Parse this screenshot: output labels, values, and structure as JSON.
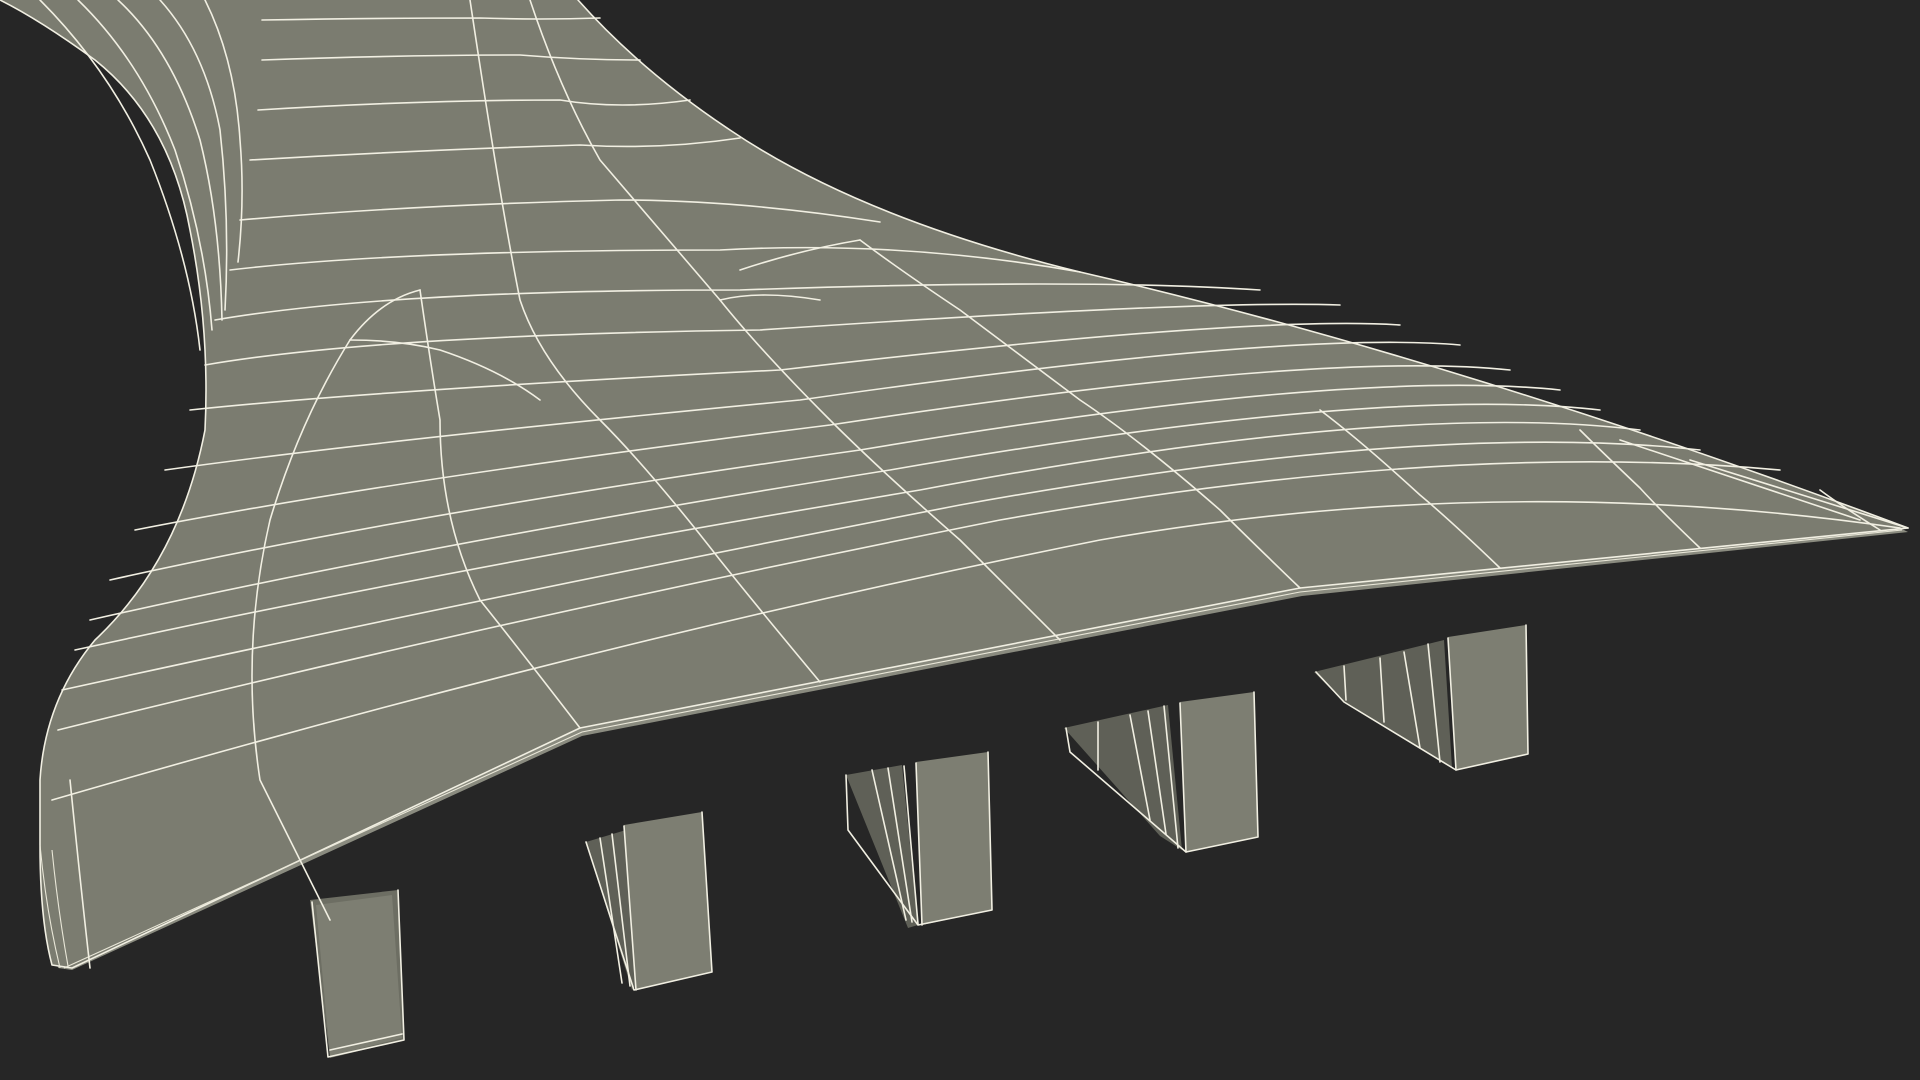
{
  "scene": {
    "background_color": "#262626",
    "surface_color": "#7b7c70",
    "pier_color": "#6d6e63",
    "wire_color": "#f1efe2",
    "pier_count": 5
  }
}
